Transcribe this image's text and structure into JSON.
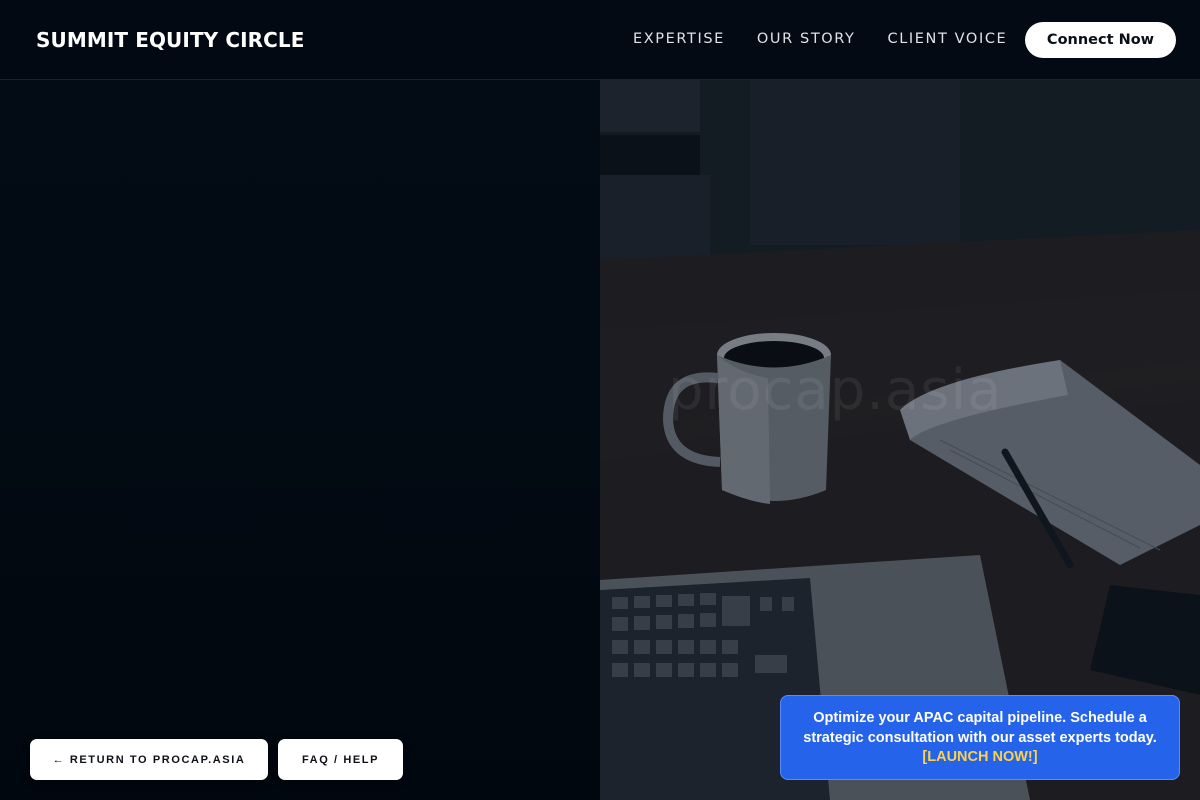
{
  "header": {
    "brand": "SUMMIT EQUITY CIRCLE",
    "nav_links": [
      "EXPERTISE",
      "OUR STORY",
      "CLIENT VOICE"
    ],
    "cta_label": "Connect Now"
  },
  "hero": {
    "watermark": "procap.asia",
    "image_description_icon": "desk-workspace-photo-icon"
  },
  "footer_buttons": {
    "return_label": "← RETURN TO PROCAP.ASIA",
    "faq_label": "FAQ / HELP"
  },
  "promo": {
    "message": "Optimize your APAC capital pipeline. Schedule a strategic consultation with our asset experts today.",
    "cta": "[LAUNCH NOW!]"
  },
  "colors": {
    "background": "#020912",
    "promo_bg": "#2563eb",
    "promo_cta": "#fbd349",
    "button_bg": "#ffffff"
  }
}
